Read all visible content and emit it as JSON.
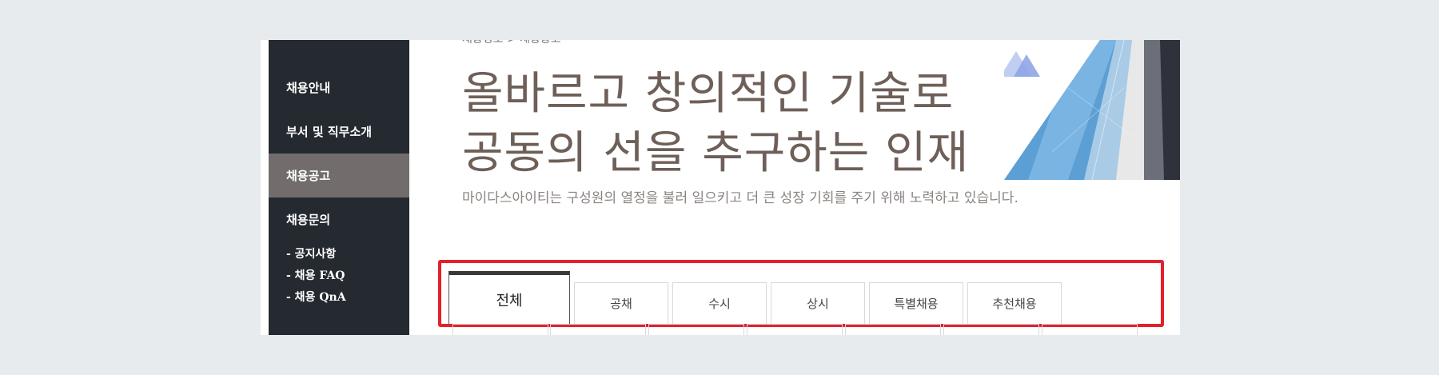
{
  "sidebar": {
    "items": [
      {
        "label": "채용안내"
      },
      {
        "label": "부서 및 직무소개"
      },
      {
        "label": "채용공고"
      },
      {
        "label": "채용문의"
      }
    ],
    "sub_items": [
      {
        "label": "- 공지사항"
      },
      {
        "label": "- 채용 FAQ"
      },
      {
        "label": "- 채용 QnA"
      }
    ],
    "active_color": "#726d6c",
    "bg_color": "#252a31"
  },
  "header": {
    "breadcrumb": "채용정보 > 채용공고",
    "headline_line1": "올바르고 창의적인 기술로",
    "headline_line2": "공동의 선을 추구하는 인재",
    "subtitle": "마이다스아이티는 구성원의 열정을 불러 일으키고 더 큰 성장 기회를 주기 위해 노력하고 있습니다."
  },
  "tabs": [
    {
      "label": "전체"
    },
    {
      "label": "공채"
    },
    {
      "label": "수시"
    },
    {
      "label": "상시"
    },
    {
      "label": "특별채용"
    },
    {
      "label": "추천채용"
    }
  ],
  "highlight_color": "#e3202b"
}
